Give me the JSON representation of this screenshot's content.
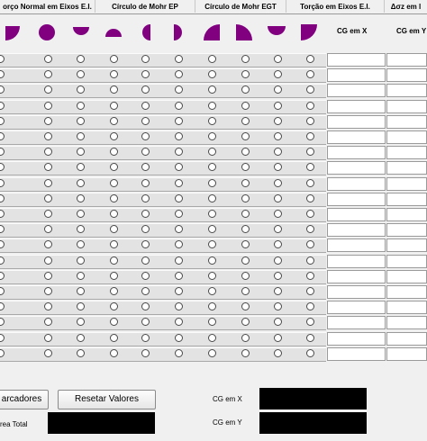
{
  "tabs": [
    "orço Normal em Eixos E.I.",
    "Círculo de Mohr EP",
    "Círculo de Mohr EGT",
    "Torção em Eixos E.I.",
    "Δσz em l"
  ],
  "colors": {
    "shape_fill": "#800080",
    "row_bg": "#e3e3e3",
    "output_bg": "#000000"
  },
  "shapes": [
    "quarter-circle-icon",
    "full-circle-icon",
    "semicircle-down-icon",
    "semicircle-up-icon",
    "semicircle-left-icon",
    "semicircle-right-icon",
    "quarter-circle-bottom-right-icon",
    "quarter-circle-bottom-left-icon",
    "semicircle-down-large-icon",
    "quarter-circle-top-left-icon"
  ],
  "table": {
    "col_cg_x": "CG em X",
    "col_cg_y": "CG em Y",
    "row_count": 20,
    "radio_columns": 10
  },
  "buttons": {
    "markers": "arcadores",
    "reset": "Resetar Valores"
  },
  "summary": {
    "area_label": "rea Total",
    "cg_x_label": "CG em X",
    "cg_y_label": "CG em Y"
  }
}
